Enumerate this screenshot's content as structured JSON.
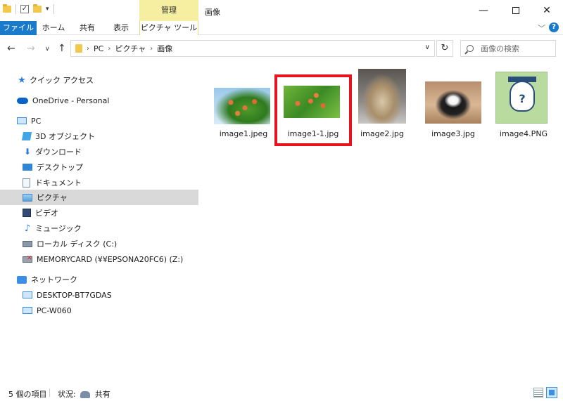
{
  "window": {
    "manage_tab": "管理",
    "title": "画像",
    "minimize": "—",
    "close": "✕"
  },
  "ribbon": {
    "tabs": [
      "ファイル",
      "ホーム",
      "共有",
      "表示",
      "ピクチャ ツール"
    ],
    "expand": "﹀",
    "help": "?"
  },
  "address": {
    "crumbs": [
      "PC",
      "ピクチャ",
      "画像"
    ],
    "separator": "›"
  },
  "search": {
    "placeholder": "画像の検索"
  },
  "sidebar": {
    "items": [
      {
        "label": "クイック アクセス",
        "icon": "star-icon"
      },
      {
        "label": "OneDrive - Personal",
        "icon": "cloud-icon"
      },
      {
        "label": "PC",
        "icon": "computer-icon"
      },
      {
        "label": "3D オブジェクト",
        "icon": "3d-objects-icon"
      },
      {
        "label": "ダウンロード",
        "icon": "download-icon"
      },
      {
        "label": "デスクトップ",
        "icon": "desktop-icon"
      },
      {
        "label": "ドキュメント",
        "icon": "document-icon"
      },
      {
        "label": "ピクチャ",
        "icon": "pictures-icon"
      },
      {
        "label": "ビデオ",
        "icon": "video-icon"
      },
      {
        "label": "ミュージック",
        "icon": "music-icon"
      },
      {
        "label": "ローカル ディスク (C:)",
        "icon": "local-disk-icon"
      },
      {
        "label": "MEMORYCARD (¥¥EPSONA20FC6) (Z:)",
        "icon": "disconnected-drive-icon"
      },
      {
        "label": "ネットワーク",
        "icon": "network-icon"
      },
      {
        "label": "DESKTOP-BT7GDAS",
        "icon": "network-computer-icon"
      },
      {
        "label": "PC-W060",
        "icon": "network-computer-icon"
      }
    ]
  },
  "files": [
    {
      "name": "image1.jpeg"
    },
    {
      "name": "image1-1.jpg"
    },
    {
      "name": "image2.jpg"
    },
    {
      "name": "image3.jpg"
    },
    {
      "name": "image4.PNG"
    }
  ],
  "status": {
    "count": "5 個の項目",
    "state_label": "状況:",
    "state_value": "共有"
  },
  "colors": {
    "file_tab": "#1979ca",
    "manage_tab": "#f6eea1",
    "selected_row": "#d9d9d9",
    "highlight": "#e8141d"
  }
}
